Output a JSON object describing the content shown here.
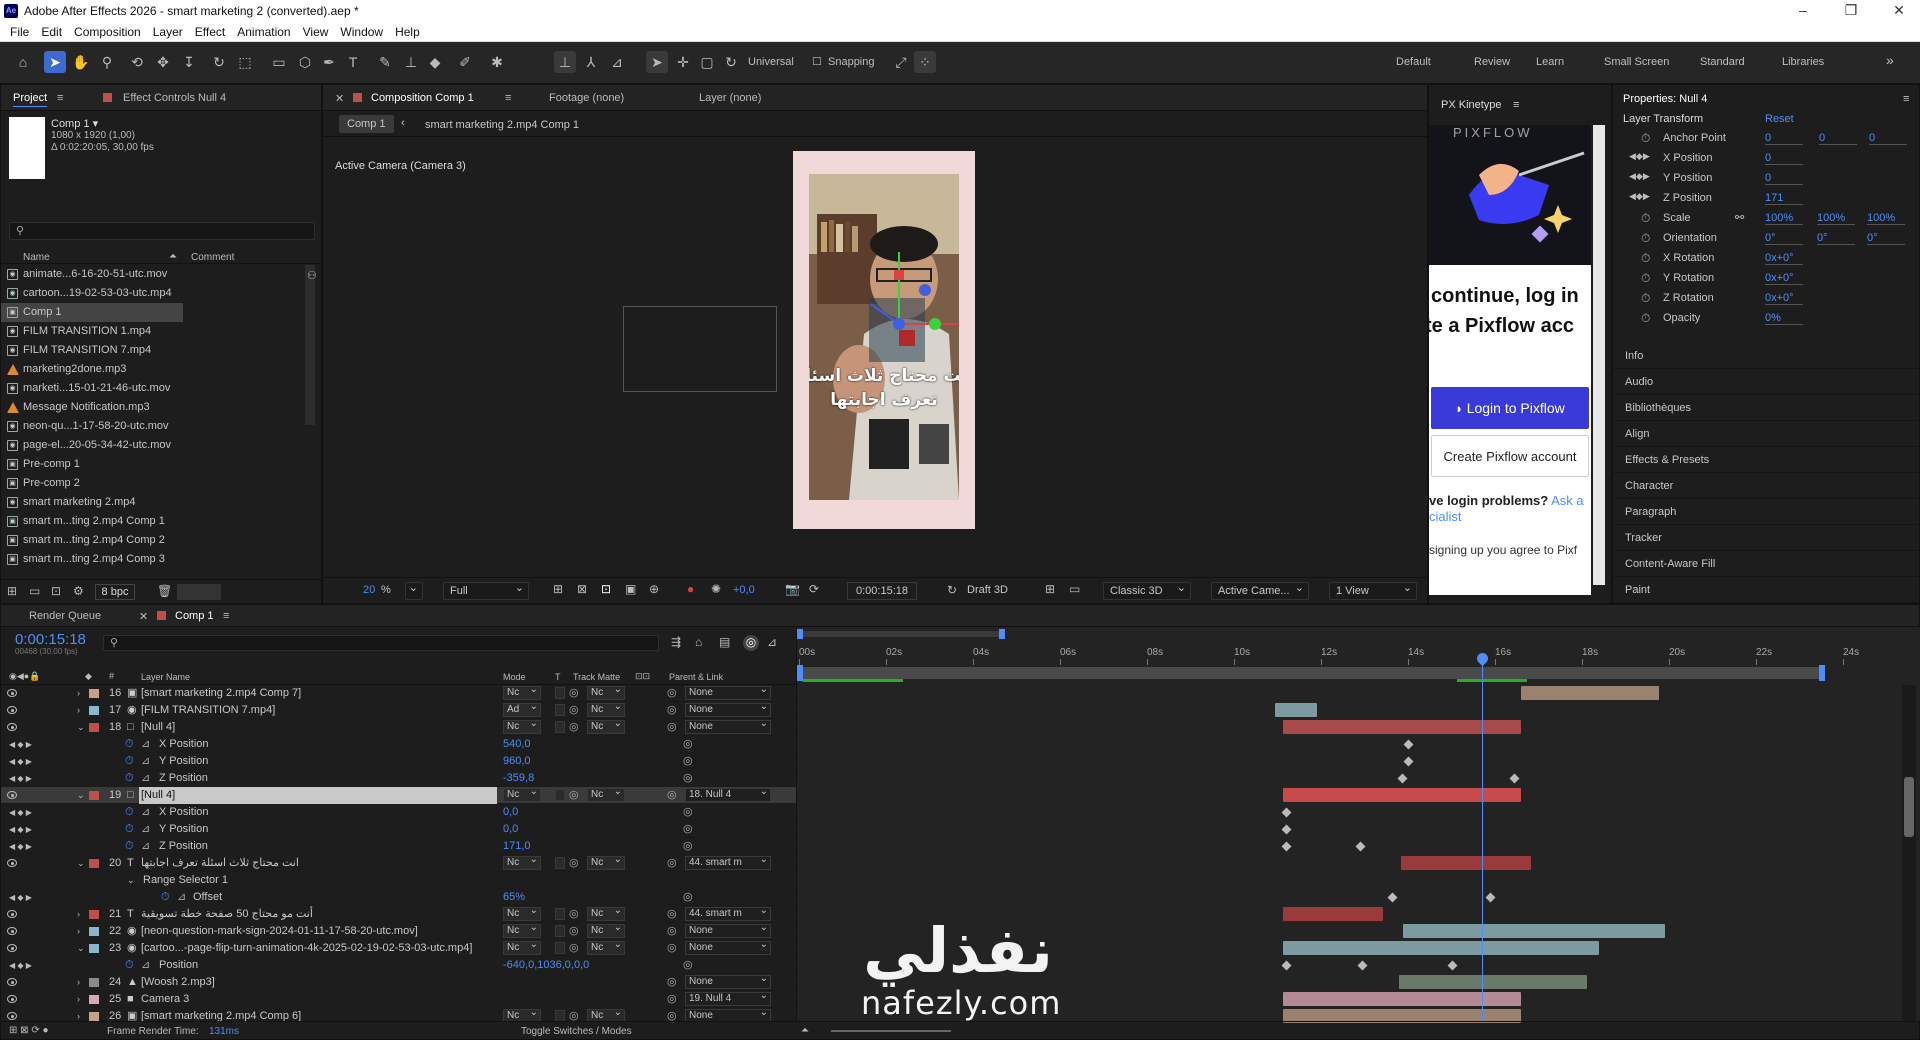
{
  "window": {
    "title": "Adobe After Effects 2026 - smart marketing 2 (converted).aep *",
    "logo": "Ae",
    "minimize": "–",
    "maximize": "❐",
    "close": "✕"
  },
  "menu": [
    "File",
    "Edit",
    "Composition",
    "Layer",
    "Effect",
    "Animation",
    "View",
    "Window",
    "Help"
  ],
  "toolbar": {
    "universal": "Universal",
    "snapping": "Snapping",
    "workspaces": [
      "Default",
      "Review",
      "Learn",
      "Small Screen",
      "Standard",
      "Libraries"
    ],
    "more": "»"
  },
  "project": {
    "tab": "Project",
    "effect_tab": "Effect Controls Null 4",
    "comp_name": "Comp 1 ▾",
    "comp_size": "1080 x 1920 (1,00)",
    "comp_duration": "Δ 0:02:20:05, 30,00 fps",
    "search_placeholder": "",
    "col_name": "Name",
    "col_comment": "Comment",
    "items": [
      {
        "name": "animate...6-16-20-51-utc.mov",
        "type": "video"
      },
      {
        "name": "cartoon...19-02-53-03-utc.mp4",
        "type": "video"
      },
      {
        "name": "Comp 1",
        "type": "comp",
        "selected": true
      },
      {
        "name": "FILM TRANSITION 1.mp4",
        "type": "video"
      },
      {
        "name": "FILM TRANSITION 7.mp4",
        "type": "video"
      },
      {
        "name": "marketing2done.mp3",
        "type": "audio"
      },
      {
        "name": "marketi...15-01-21-46-utc.mov",
        "type": "video"
      },
      {
        "name": "Message Notification.mp3",
        "type": "audio"
      },
      {
        "name": "neon-qu...1-17-58-20-utc.mov",
        "type": "video"
      },
      {
        "name": "page-el...20-05-34-42-utc.mov",
        "type": "video"
      },
      {
        "name": "Pre-comp 1",
        "type": "comp"
      },
      {
        "name": "Pre-comp 2",
        "type": "comp"
      },
      {
        "name": "smart marketing 2.mp4",
        "type": "video"
      },
      {
        "name": "smart m...ting 2.mp4 Comp 1",
        "type": "comp"
      },
      {
        "name": "smart m...ting 2.mp4 Comp 2",
        "type": "comp"
      },
      {
        "name": "smart m...ting 2.mp4 Comp 3",
        "type": "comp"
      }
    ],
    "bpc": "8 bpc"
  },
  "composition": {
    "tab": "Composition Comp 1",
    "footage_tab": "Footage (none)",
    "layer_tab": "Layer (none)",
    "crumb1": "Comp 1",
    "crumb2": "smart marketing 2.mp4 Comp 1",
    "camera_label": "Active Camera (Camera 3)",
    "caption_line1": "انت محتاج ثلاث اسئلة",
    "caption_line2": "تعرف اجابتها",
    "zoom": "20",
    "zoom_unit": "%",
    "resolution": "Full",
    "exposure": "+0,0",
    "timecode": "0:00:15:18",
    "draft": "Draft 3D",
    "renderer": "Classic 3D",
    "camera": "Active Came...",
    "views": "1 View"
  },
  "pixflow": {
    "tab": "PX Kinetype",
    "brand": "PIXFLOW",
    "line1": "continue, log in",
    "line2": "te a Pixflow acc",
    "login_btn": "Login to Pixflow",
    "create_btn": "Create Pixflow account",
    "problem": "ve login problems?",
    "ask": "Ask a",
    "specialist": "cialist",
    "signup": "signing up you agree to Pixf"
  },
  "properties": {
    "title": "Properties: Null 4",
    "section": "Layer Transform",
    "reset": "Reset",
    "rows": [
      {
        "name": "Anchor Point",
        "vals": [
          "0",
          "0",
          "0"
        ]
      },
      {
        "name": "X Position",
        "vals": [
          "0"
        ]
      },
      {
        "name": "Y Position",
        "vals": [
          "0"
        ]
      },
      {
        "name": "Z Position",
        "vals": [
          "171"
        ]
      },
      {
        "name": "Scale",
        "vals": [
          "100%",
          "100%",
          "100%"
        ]
      },
      {
        "name": "Orientation",
        "vals": [
          "0°",
          "0°",
          "0°"
        ]
      },
      {
        "name": "X Rotation",
        "vals": [
          "0x+0°"
        ]
      },
      {
        "name": "Y Rotation",
        "vals": [
          "0x+0°"
        ]
      },
      {
        "name": "Z Rotation",
        "vals": [
          "0x+0°"
        ]
      },
      {
        "name": "Opacity",
        "vals": [
          "0%"
        ]
      }
    ],
    "panels": [
      "Info",
      "Audio",
      "Bibliothèques",
      "Align",
      "Effects & Presets",
      "Character",
      "Paragraph",
      "Tracker",
      "Content-Aware Fill",
      "Paint"
    ]
  },
  "timeline": {
    "render_tab": "Render Queue",
    "comp_tab": "Comp 1",
    "timecode": "0:00:15:18",
    "frames": "00468 (30.00 fps)",
    "col_layer": "Layer Name",
    "col_mode": "Mode",
    "col_t": "T",
    "col_track": "Track Matte",
    "col_parent": "Parent & Link",
    "ruler": [
      "00s",
      "02s",
      "04s",
      "06s",
      "08s",
      "10s",
      "12s",
      "14s",
      "16s",
      "18s",
      "20s",
      "22s",
      "24s"
    ],
    "rows": [
      {
        "num": "16",
        "name": "[smart marketing 2.mp4 Comp 7]",
        "mode": "Nc",
        "track": "Nc",
        "parent": "None",
        "color": "#c7a08a",
        "kind": "layer",
        "icon": "comp"
      },
      {
        "num": "17",
        "name": "[FILM TRANSITION 7.mp4]",
        "mode": "Ad",
        "track": "Nc",
        "parent": "None",
        "color": "#8ab8c8",
        "kind": "layer",
        "icon": "video"
      },
      {
        "num": "18",
        "name": "[Null 4]",
        "mode": "Nc",
        "track": "Nc",
        "parent": "None",
        "color": "#c24d4d",
        "kind": "layer",
        "icon": "null",
        "open": true
      },
      {
        "name": "X Position",
        "value": "540,0",
        "kind": "prop"
      },
      {
        "name": "Y Position",
        "value": "960,0",
        "kind": "prop"
      },
      {
        "name": "Z Position",
        "value": "-359,8",
        "kind": "prop"
      },
      {
        "num": "19",
        "name": "[Null 4]",
        "mode": "Nc",
        "track": "Nc",
        "parent": "18. Null 4",
        "color": "#c24d4d",
        "kind": "layer",
        "icon": "null",
        "open": true,
        "selected": true
      },
      {
        "name": "X Position",
        "value": "0,0",
        "kind": "prop"
      },
      {
        "name": "Y Position",
        "value": "0,0",
        "kind": "prop"
      },
      {
        "name": "Z Position",
        "value": "171,0",
        "kind": "prop"
      },
      {
        "num": "20",
        "name": "انت محتاج ثلاث اسئلة  تعرف اجابتها",
        "mode": "Nc",
        "track": "Nc",
        "parent": "44. smart m",
        "color": "#c24d4d",
        "kind": "layer",
        "icon": "text",
        "open": true
      },
      {
        "name": "Range Selector 1",
        "kind": "group"
      },
      {
        "name": "Offset",
        "value": "65%",
        "kind": "prop2"
      },
      {
        "num": "21",
        "name": "أنت مو محتاج 50  صفحة خطة تسويقية",
        "mode": "Nc",
        "track": "Nc",
        "parent": "44. smart m",
        "color": "#c24d4d",
        "kind": "layer",
        "icon": "text"
      },
      {
        "num": "22",
        "name": "[neon-question-mark-sign-2024-01-11-17-58-20-utc.mov]",
        "mode": "Nc",
        "track": "Nc",
        "parent": "None",
        "color": "#8ab8c8",
        "kind": "layer",
        "icon": "video"
      },
      {
        "num": "23",
        "name": "[cartoo...-page-flip-turn-animation-4k-2025-02-19-02-53-03-utc.mp4]",
        "mode": "Nc",
        "track": "Nc",
        "parent": "None",
        "color": "#8ab8c8",
        "kind": "layer",
        "icon": "video",
        "open": true
      },
      {
        "name": "Position",
        "value": "-640,0,1036,0,0,0",
        "kind": "prop"
      },
      {
        "num": "24",
        "name": "[Woosh 2.mp3]",
        "mode": "",
        "track": "",
        "parent": "None",
        "color": "#8a8a8a",
        "kind": "layer",
        "icon": "audio"
      },
      {
        "num": "25",
        "name": "Camera 3",
        "mode": "",
        "track": "",
        "parent": "19. Null 4",
        "color": "#d6a7b5",
        "kind": "layer",
        "icon": "camera"
      },
      {
        "num": "26",
        "name": "[smart marketing 2.mp4 Comp 6]",
        "mode": "Nc",
        "track": "Nc",
        "parent": "None",
        "color": "#c7a08a",
        "kind": "layer",
        "icon": "comp"
      }
    ],
    "footer_render": "Frame Render Time:",
    "render_ms": "131ms",
    "toggle": "Toggle Switches / Modes"
  },
  "watermark": {
    "arabic": "نفذلي",
    "latin": "nafezly.com"
  }
}
